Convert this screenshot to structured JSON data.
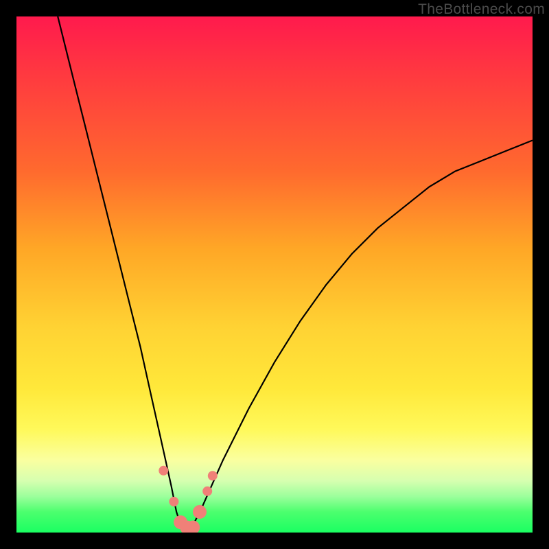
{
  "watermark": "TheBottleneck.com",
  "chart_data": {
    "type": "line",
    "title": "",
    "xlabel": "",
    "ylabel": "",
    "xlim": [
      0,
      100
    ],
    "ylim": [
      0,
      100
    ],
    "grid": false,
    "legend": false,
    "background_gradient": {
      "stops": [
        {
          "pos": 0,
          "color": "#ff1a4d"
        },
        {
          "pos": 50,
          "color": "#ffd233"
        },
        {
          "pos": 86,
          "color": "#faffa0"
        },
        {
          "pos": 100,
          "color": "#1aff62"
        }
      ],
      "note": "Heatmap-style vertical gradient; red at top (high bottleneck), green at bottom (low bottleneck)."
    },
    "series": [
      {
        "name": "bottleneck-curve",
        "color": "#000000",
        "x": [
          8,
          10,
          12,
          14,
          16,
          18,
          20,
          22,
          24,
          26,
          28,
          30,
          31,
          32,
          33,
          34,
          36,
          40,
          45,
          50,
          55,
          60,
          65,
          70,
          75,
          80,
          85,
          90,
          95,
          100
        ],
        "y": [
          100,
          92,
          84,
          76,
          68,
          60,
          52,
          44,
          36,
          27,
          18,
          9,
          4,
          1,
          0,
          1,
          5,
          14,
          24,
          33,
          41,
          48,
          54,
          59,
          63,
          67,
          70,
          72,
          74,
          76
        ]
      },
      {
        "name": "highlight-markers",
        "color": "#f08078",
        "type": "scatter",
        "x": [
          28.5,
          30.5,
          31.8,
          33.0,
          34.2,
          35.5,
          37.0,
          38.0
        ],
        "y": [
          12,
          6,
          2,
          1,
          1,
          4,
          8,
          11
        ]
      }
    ],
    "annotations": []
  }
}
